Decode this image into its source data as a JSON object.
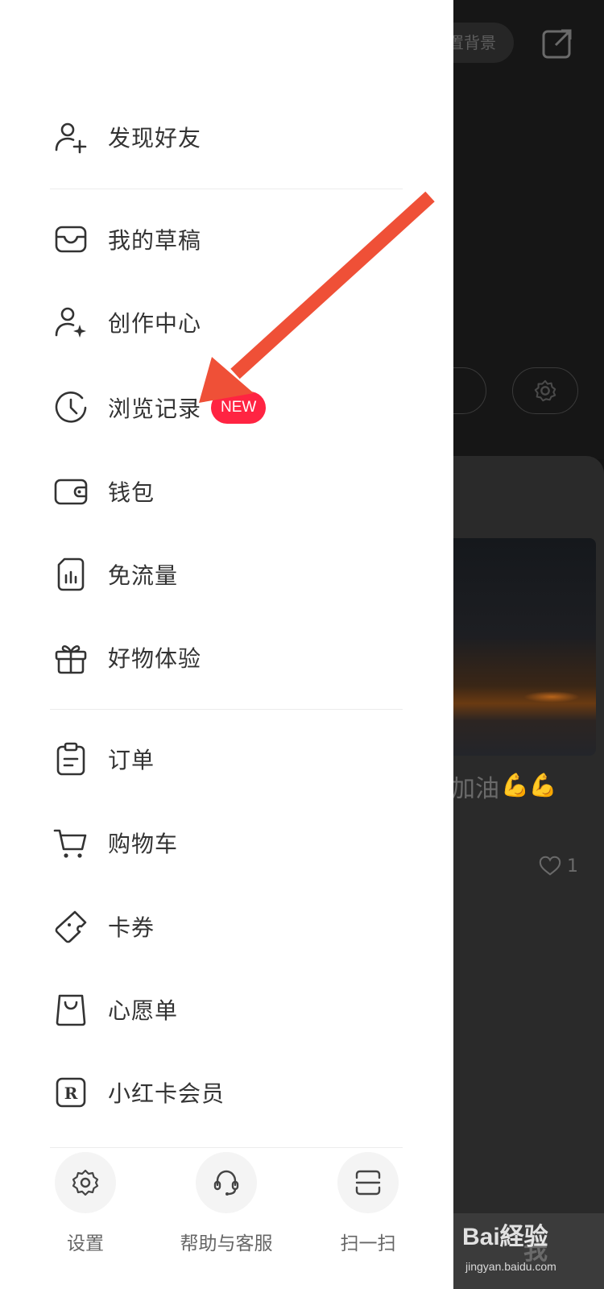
{
  "drawer": {
    "items": [
      {
        "label": "发现好友",
        "icon": "add-friend-icon"
      },
      {
        "label": "我的草稿",
        "icon": "inbox-tray-icon"
      },
      {
        "label": "创作中心",
        "icon": "creator-icon"
      },
      {
        "label": "浏览记录",
        "icon": "history-clock-icon",
        "badge": "NEW"
      },
      {
        "label": "钱包",
        "icon": "wallet-icon"
      },
      {
        "label": "免流量",
        "icon": "sim-card-icon"
      },
      {
        "label": "好物体验",
        "icon": "gift-icon"
      },
      {
        "label": "订单",
        "icon": "clipboard-icon"
      },
      {
        "label": "购物车",
        "icon": "cart-icon"
      },
      {
        "label": "卡券",
        "icon": "ticket-icon"
      },
      {
        "label": "心愿单",
        "icon": "wish-bag-icon"
      },
      {
        "label": "小红卡会员",
        "icon": "membership-r-icon"
      }
    ],
    "actions": [
      {
        "label": "设置",
        "icon": "settings-gear-icon"
      },
      {
        "label": "帮助与客服",
        "icon": "headset-icon"
      },
      {
        "label": "扫一扫",
        "icon": "scan-icon"
      }
    ]
  },
  "background": {
    "bg_button": "置背景",
    "card_title": "加油",
    "like_count": "1",
    "tab_me": "我",
    "watermark": "Bai経验",
    "watermark_url": "jingyan.baidu.com"
  },
  "colors": {
    "badge": "#ff2442",
    "annotation_arrow": "#ef5037"
  }
}
